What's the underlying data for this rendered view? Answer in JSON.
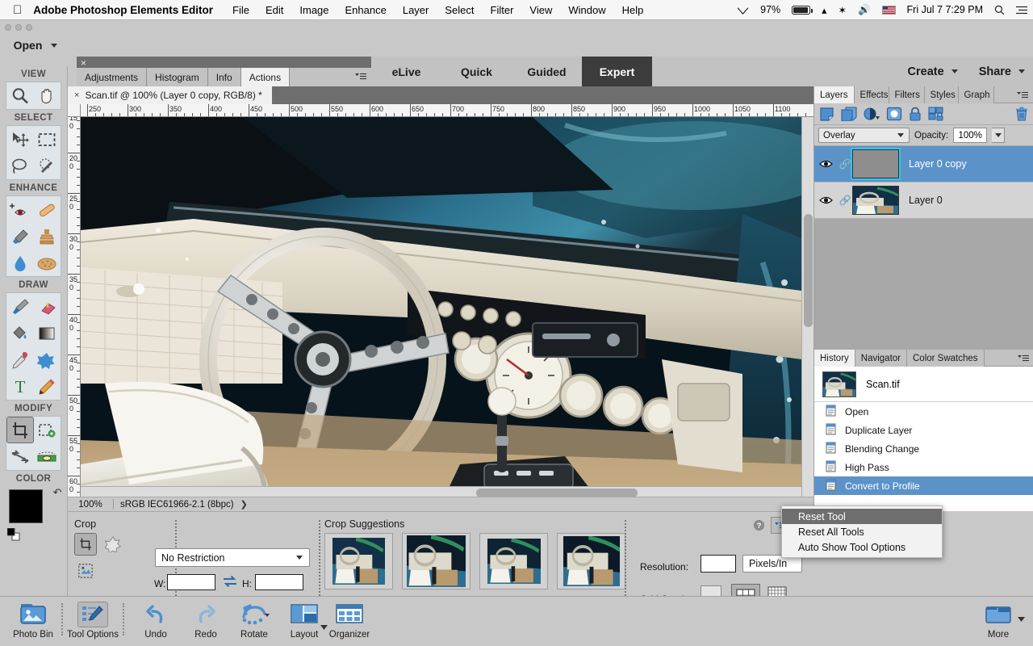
{
  "macmenu": {
    "apple_icon": "apple-icon",
    "app_name": "Adobe Photoshop Elements Editor",
    "items": [
      "File",
      "Edit",
      "Image",
      "Enhance",
      "Layer",
      "Select",
      "Filter",
      "View",
      "Window",
      "Help"
    ],
    "status": {
      "wifi_icon": "wifi-icon",
      "battery_percent": "97%",
      "battery_icon": "battery-icon",
      "eject_icon": "eject-icon",
      "bluetooth_icon": "bluetooth-icon",
      "volume_icon": "volume-icon",
      "flag_icon": "us-flag-icon",
      "datetime": "Fri Jul 7  7:29 PM",
      "search_icon": "search-icon",
      "notification_icon": "notification-center-icon"
    }
  },
  "topbar": {
    "open_label": "Open",
    "bin_tabs": [
      {
        "label": "Adjustments",
        "active": false
      },
      {
        "label": "Histogram",
        "active": false
      },
      {
        "label": "Info",
        "active": false
      },
      {
        "label": "Actions",
        "active": true
      }
    ],
    "mode_tabs": [
      {
        "label": "eLive",
        "active": false
      },
      {
        "label": "Quick",
        "active": false
      },
      {
        "label": "Guided",
        "active": false
      },
      {
        "label": "Expert",
        "active": true
      }
    ],
    "create_label": "Create",
    "share_label": "Share"
  },
  "toolbox": {
    "sections": [
      {
        "label": "VIEW",
        "tools": [
          {
            "name": "zoom-tool",
            "icon": "magnifier-icon",
            "selected": false
          },
          {
            "name": "hand-tool",
            "icon": "hand-icon",
            "selected": false
          }
        ]
      },
      {
        "label": "SELECT",
        "tools": [
          {
            "name": "move-tool",
            "icon": "move-arrow-icon",
            "selected": false
          },
          {
            "name": "rectangular-marquee-tool",
            "icon": "marquee-icon",
            "selected": false
          },
          {
            "name": "lasso-tool",
            "icon": "lasso-icon",
            "selected": false
          },
          {
            "name": "quick-selection-tool",
            "icon": "magic-wand-icon",
            "selected": false
          }
        ]
      },
      {
        "label": "ENHANCE",
        "tools": [
          {
            "name": "red-eye-removal-tool",
            "icon": "eye-plus-icon",
            "selected": false
          },
          {
            "name": "spot-healing-brush-tool",
            "icon": "bandage-icon",
            "selected": false
          },
          {
            "name": "smart-brush-tool",
            "icon": "brush-icon",
            "selected": false
          },
          {
            "name": "clone-stamp-tool",
            "icon": "stamp-icon",
            "selected": false
          },
          {
            "name": "blur-tool",
            "icon": "water-drop-icon",
            "selected": false
          },
          {
            "name": "sponge-tool",
            "icon": "sponge-icon",
            "selected": false
          }
        ]
      },
      {
        "label": "DRAW",
        "tools": [
          {
            "name": "brush-tool",
            "icon": "paintbrush-icon",
            "selected": false
          },
          {
            "name": "eraser-tool",
            "icon": "eraser-icon",
            "selected": false
          },
          {
            "name": "paint-bucket-tool",
            "icon": "paint-bucket-icon",
            "selected": false
          },
          {
            "name": "gradient-tool",
            "icon": "gradient-icon",
            "selected": false
          },
          {
            "name": "color-picker-tool",
            "icon": "eyedropper-icon",
            "selected": false
          },
          {
            "name": "custom-shape-tool",
            "icon": "shape-star-icon",
            "selected": false
          },
          {
            "name": "type-tool",
            "icon": "text-t-icon",
            "selected": false
          },
          {
            "name": "pencil-tool",
            "icon": "pencil-icon",
            "selected": false
          }
        ]
      },
      {
        "label": "MODIFY",
        "tools": [
          {
            "name": "crop-tool",
            "icon": "crop-icon",
            "selected": true
          },
          {
            "name": "recompose-tool",
            "icon": "recompose-icon",
            "selected": false
          },
          {
            "name": "content-aware-move-tool",
            "icon": "content-move-icon",
            "selected": false
          },
          {
            "name": "straighten-tool",
            "icon": "straighten-icon",
            "selected": false
          }
        ]
      }
    ],
    "color_label": "COLOR",
    "foreground_color": "#000000",
    "background_color": "#ffffff"
  },
  "document": {
    "tab_title": "Scan.tif @ 100% (Layer 0 copy, RGB/8) *",
    "ruler_h_ticks": [
      "250",
      "300",
      "350",
      "400",
      "450",
      "500",
      "550",
      "600",
      "650",
      "700",
      "750",
      "800",
      "850",
      "900",
      "950",
      "1000",
      "1050",
      "1100"
    ],
    "ruler_v_ticks": [
      "150",
      "200",
      "250",
      "300",
      "350",
      "400",
      "450",
      "500",
      "550",
      "600"
    ],
    "status": {
      "zoom": "100%",
      "color_profile": "sRGB IEC61966-2.1 (8bpc)",
      "arrow_icon": "chevron-right-icon"
    }
  },
  "layers_panel": {
    "tabs": [
      {
        "label": "Layers",
        "active": true
      },
      {
        "label": "Effects",
        "active": false
      },
      {
        "label": "Filters",
        "active": false
      },
      {
        "label": "Styles",
        "active": false
      },
      {
        "label": "Graph",
        "active": false
      }
    ],
    "menu_icon": "panel-menu-icon",
    "tools": [
      {
        "name": "add-layer-button",
        "icon": "new-layer-icon"
      },
      {
        "name": "duplicate-layer-button",
        "icon": "duplicate-layer-icon"
      },
      {
        "name": "adjustment-layer-button",
        "icon": "adjustment-circle-icon"
      },
      {
        "name": "layer-mask-button",
        "icon": "layer-mask-icon"
      },
      {
        "name": "lock-layer-button",
        "icon": "lock-icon"
      },
      {
        "name": "link-layers-button",
        "icon": "link-layers-icon"
      },
      {
        "name": "delete-layer-button",
        "icon": "trash-icon"
      }
    ],
    "blend_mode": "Overlay",
    "opacity_label": "Opacity:",
    "opacity_value": "100%",
    "layers": [
      {
        "name": "Layer 0 copy",
        "selected": true,
        "visible": true
      },
      {
        "name": "Layer 0",
        "selected": false,
        "visible": true
      }
    ]
  },
  "history_panel": {
    "tabs": [
      {
        "label": "History",
        "active": true
      },
      {
        "label": "Navigator",
        "active": false
      },
      {
        "label": "Color Swatches",
        "active": false
      }
    ],
    "menu_icon": "panel-menu-icon",
    "source_name": "Scan.tif",
    "states": [
      {
        "label": "Open",
        "selected": false
      },
      {
        "label": "Duplicate Layer",
        "selected": false
      },
      {
        "label": "Blending Change",
        "selected": false
      },
      {
        "label": "High Pass",
        "selected": false
      },
      {
        "label": "Convert to Profile",
        "selected": true
      }
    ]
  },
  "tool_options": {
    "crop_title": "Crop",
    "crop_modes": [
      {
        "name": "crop-tool-option",
        "icon": "crop-icon",
        "selected": true
      },
      {
        "name": "cookie-cutter-tool-option",
        "icon": "cookie-cutter-icon",
        "selected": false
      },
      {
        "name": "perspective-crop-tool-option",
        "icon": "perspective-crop-icon",
        "selected": false
      }
    ],
    "restriction_value": "No Restriction",
    "width_label": "W:",
    "width_value": "",
    "height_label": "H:",
    "height_value": "",
    "swap_icon": "swap-arrows-icon",
    "suggestions_title": "Crop Suggestions",
    "suggestion_count": 4,
    "resolution_label": "Resolution:",
    "resolution_value": "",
    "resolution_unit": "Pixels/In",
    "grid_overlay_label": "Grid Overlay:",
    "grid_options": [
      {
        "name": "grid-overlay-none",
        "icon": "blank-grid-icon",
        "selected": false
      },
      {
        "name": "grid-overlay-rule-of-thirds",
        "icon": "thirds-grid-icon",
        "selected": true
      },
      {
        "name": "grid-overlay-fine",
        "icon": "fine-grid-icon",
        "selected": false
      }
    ],
    "help_icon": "help-question-icon",
    "panel_menu_icon": "panel-menu-icon",
    "collapse_icon": "chevron-down-icon"
  },
  "context_menu": {
    "items": [
      {
        "label": "Reset Tool",
        "highlighted": true
      },
      {
        "label": "Reset All Tools",
        "highlighted": false
      },
      {
        "label": "Auto Show Tool Options",
        "highlighted": false
      }
    ]
  },
  "taskbar": {
    "items": [
      {
        "label": "Photo Bin",
        "icon": "photo-bin-icon",
        "selected": false
      },
      {
        "label": "Tool Options",
        "icon": "tool-options-icon",
        "selected": true
      },
      {
        "label": "Undo",
        "icon": "undo-arrow-icon",
        "selected": false
      },
      {
        "label": "Redo",
        "icon": "redo-arrow-icon",
        "selected": false
      },
      {
        "label": "Rotate",
        "icon": "rotate-icon",
        "selected": false
      },
      {
        "label": "Layout",
        "icon": "layout-icon",
        "selected": false
      },
      {
        "label": "Organizer",
        "icon": "organizer-grid-icon",
        "selected": false
      }
    ],
    "more_label": "More",
    "more_icon": "more-panels-icon"
  },
  "colors": {
    "selection_blue": "#5b93c9",
    "expert_tab_bg": "#3c3c3c",
    "app_gray": "#c8c8c8",
    "panel_dark": "#6e6e6e"
  }
}
